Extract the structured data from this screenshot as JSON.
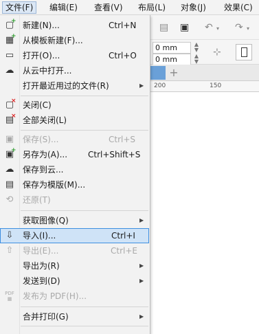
{
  "menubar": {
    "items": [
      {
        "label": "文件(F)",
        "active": true
      },
      {
        "label": "编辑(E)"
      },
      {
        "label": "查看(V)"
      },
      {
        "label": "布局(L)"
      },
      {
        "label": "对象(J)"
      },
      {
        "label": "效果(C)"
      }
    ]
  },
  "propbar": {
    "field1": "0 mm",
    "field2": "0 mm"
  },
  "ruler": {
    "ticks": [
      "200",
      "150"
    ]
  },
  "file_menu": {
    "items": [
      {
        "label": "新建(N)...",
        "shortcut": "Ctrl+N",
        "icon": "new-document-icon"
      },
      {
        "label": "从模板新建(F)...",
        "icon": "new-from-template-icon"
      },
      {
        "label": "打开(O)...",
        "shortcut": "Ctrl+O",
        "icon": "open-folder-icon"
      },
      {
        "label": "从云中打开...",
        "icon": "cloud-open-icon"
      },
      {
        "label": "打开最近用过的文件(R)",
        "submenu": true
      },
      {
        "label": "关闭(C)",
        "icon": "close-document-icon"
      },
      {
        "label": "全部关闭(L)",
        "icon": "close-all-icon"
      },
      {
        "label": "保存(S)...",
        "shortcut": "Ctrl+S",
        "disabled": true,
        "icon": "save-icon"
      },
      {
        "label": "另存为(A)...",
        "shortcut": "Ctrl+Shift+S",
        "icon": "save-as-icon"
      },
      {
        "label": "保存到云...",
        "icon": "cloud-save-icon"
      },
      {
        "label": "保存为模版(M)...",
        "icon": "save-template-icon"
      },
      {
        "label": "还原(T)",
        "disabled": true,
        "icon": "revert-icon"
      },
      {
        "label": "获取图像(Q)",
        "submenu": true
      },
      {
        "label": "导入(I)...",
        "shortcut": "Ctrl+I",
        "highlighted": true,
        "icon": "import-icon"
      },
      {
        "label": "导出(E)...",
        "shortcut": "Ctrl+E",
        "disabled": true,
        "icon": "export-icon"
      },
      {
        "label": "导出为(R)",
        "submenu": true
      },
      {
        "label": "发送到(D)",
        "submenu": true
      },
      {
        "label": "发布为 PDF(H)...",
        "disabled": true,
        "icon": "pdf-icon"
      },
      {
        "label": "合并打印(G)",
        "submenu": true
      }
    ]
  }
}
